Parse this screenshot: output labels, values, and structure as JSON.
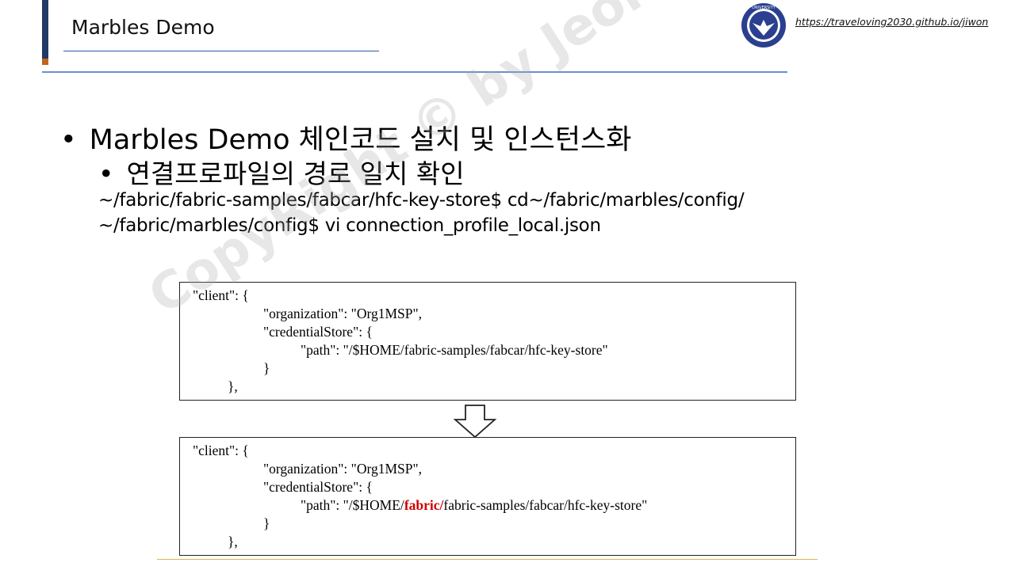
{
  "header": {
    "title": "Marbles Demo",
    "url": "https://traveloving2030.github.io/jiwon",
    "logo_text": "UNIVERSITY"
  },
  "bullets": {
    "level1": "Marbles Demo 체인코드 설치 및 인스턴스화",
    "level2": "연결프로파일의 경로 일치 확인",
    "dot": "•"
  },
  "commands": [
    "~/fabric/fabric-samples/fabcar/hfc-key-store$ cd~/fabric/marbles/config/",
    "~/fabric/marbles/config$ vi connection_profile_local.json"
  ],
  "code_before": {
    "line1": "\"client\": {",
    "line2": "\"organization\": \"Org1MSP\",",
    "line3": "\"credentialStore\": {",
    "line4": "\"path\": \"/$HOME/fabric-samples/fabcar/hfc-key-store\"",
    "line5": "}",
    "line6": "},"
  },
  "code_after": {
    "line1": "\"client\": {",
    "line2": "\"organization\": \"Org1MSP\",",
    "line3": "\"credentialStore\": {",
    "line4_prefix": "\"path\": \"/$HOME/",
    "line4_highlight": "fabric/",
    "line4_suffix": "fabric-samples/fabcar/hfc-key-store\"",
    "line5": "}",
    "line6": "},"
  },
  "watermark": "CopyRight © by Jeong JiWon",
  "colors": {
    "accent_navy": "#1f3a64",
    "accent_orange": "#c0651c",
    "header_rule": "#6b8fcf",
    "highlight_red": "#d00000"
  }
}
